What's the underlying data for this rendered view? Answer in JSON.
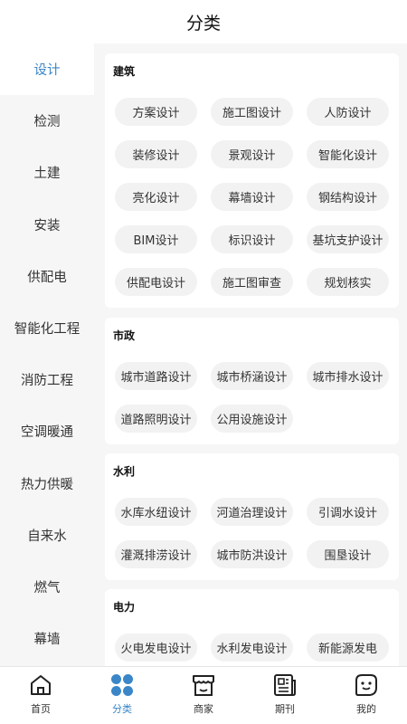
{
  "header": {
    "title": "分类"
  },
  "sidebar": {
    "items": [
      {
        "label": "设计"
      },
      {
        "label": "检测"
      },
      {
        "label": "土建"
      },
      {
        "label": "安装"
      },
      {
        "label": "供配电"
      },
      {
        "label": "智能化工程"
      },
      {
        "label": "消防工程"
      },
      {
        "label": "空调暖通"
      },
      {
        "label": "热力供暖"
      },
      {
        "label": "自来水"
      },
      {
        "label": "燃气"
      },
      {
        "label": "幕墙"
      }
    ]
  },
  "sections": [
    {
      "title": "建筑",
      "items": [
        "方案设计",
        "施工图设计",
        "人防设计",
        "装修设计",
        "景观设计",
        "智能化设计",
        "亮化设计",
        "幕墙设计",
        "钢结构设计",
        "BIM设计",
        "标识设计",
        "基坑支护设计",
        "供配电设计",
        "施工图审查",
        "规划核实"
      ]
    },
    {
      "title": "市政",
      "items": [
        "城市道路设计",
        "城市桥涵设计",
        "城市排水设计",
        "道路照明设计",
        "公用设施设计"
      ]
    },
    {
      "title": "水利",
      "items": [
        "水库水纽设计",
        "河道治理设计",
        "引调水设计",
        "灌溉排涝设计",
        "城市防洪设计",
        "围垦设计"
      ]
    },
    {
      "title": "电力",
      "items": [
        "火电发电设计",
        "水利发电设计",
        "新能源发电"
      ]
    }
  ],
  "tabbar": {
    "items": [
      {
        "label": "首页",
        "icon": "home-icon"
      },
      {
        "label": "分类",
        "icon": "category-grid-icon"
      },
      {
        "label": "商家",
        "icon": "store-icon"
      },
      {
        "label": "期刊",
        "icon": "newspaper-icon"
      },
      {
        "label": "我的",
        "icon": "profile-icon"
      }
    ]
  },
  "colors": {
    "accent": "#3a86c8",
    "sidebar_bg": "#f6f6f6",
    "chip_bg": "#f2f2f2"
  }
}
